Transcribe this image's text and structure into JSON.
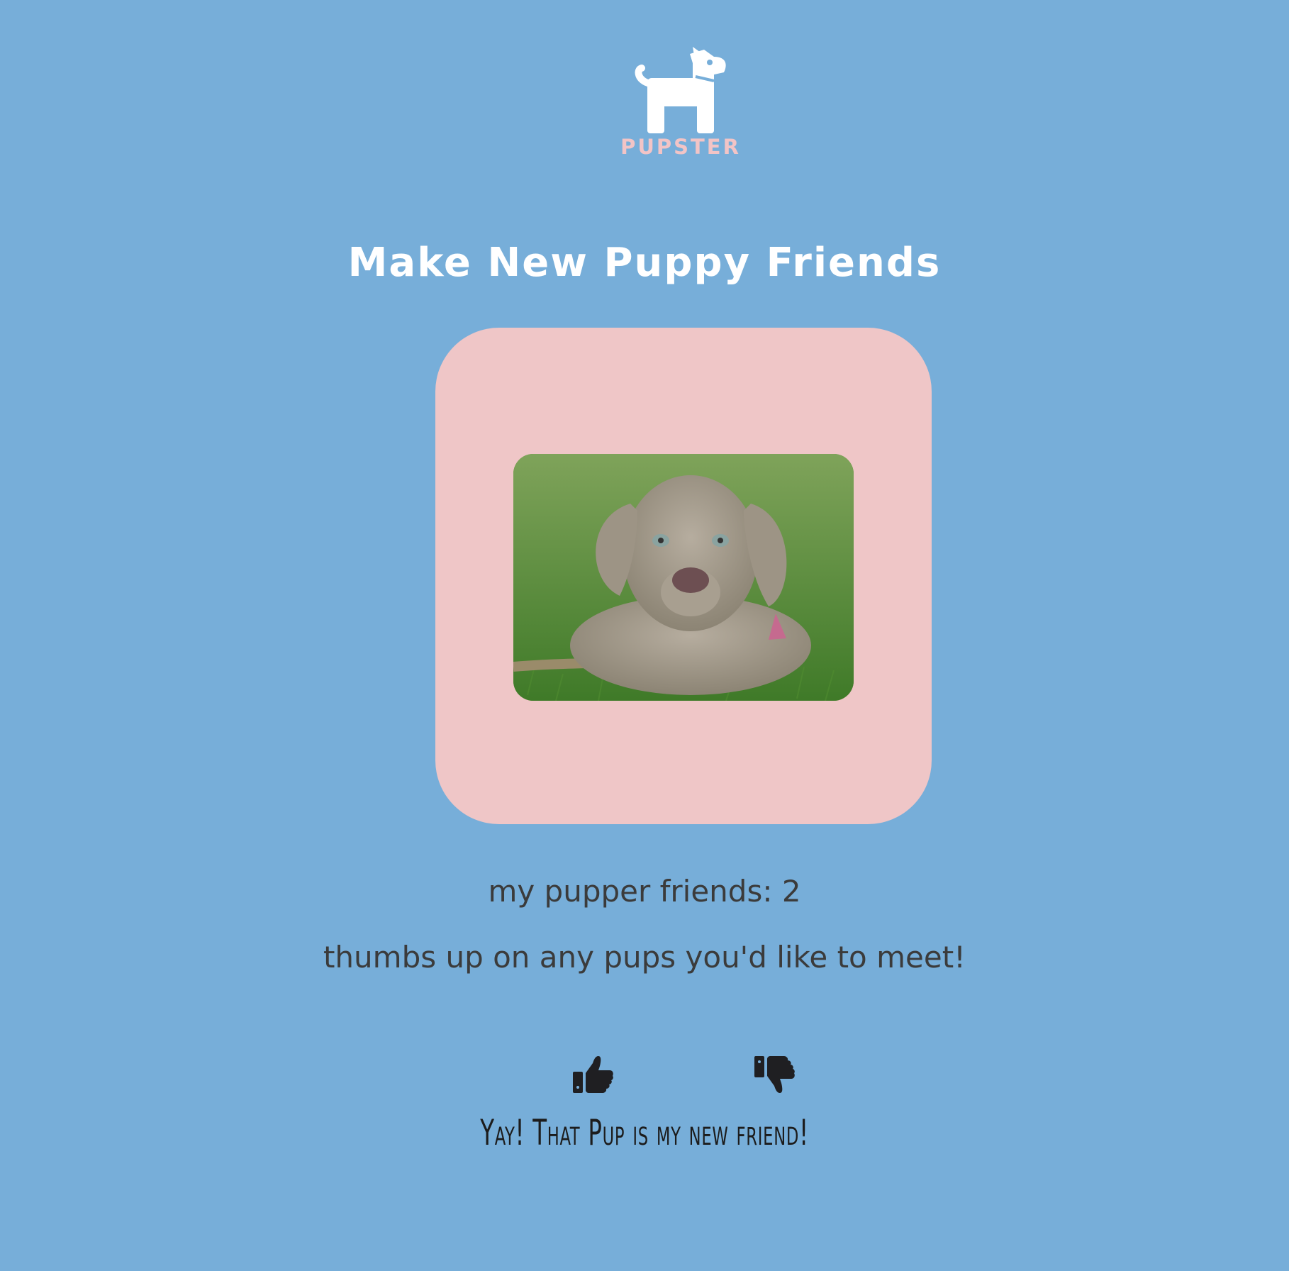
{
  "header": {
    "logo_icon": "dog-icon",
    "brand_name": "PUPSTER",
    "brand_color": "#f2c4c6"
  },
  "main": {
    "title": "Make New Puppy Friends",
    "card_color": "#efc6c7",
    "photo_subject": "puppy lying on grass",
    "friends_label": "my pupper friends: 2",
    "instructions": "thumbs up on any pups you'd like to meet!",
    "vote_buttons": [
      {
        "icon": "thumbs-up-icon"
      },
      {
        "icon": "thumbs-down-icon"
      }
    ],
    "result_message": "Yay! That Pup is my new friend!"
  },
  "colors": {
    "background": "#77aed9",
    "text": "#3b3b3b"
  }
}
